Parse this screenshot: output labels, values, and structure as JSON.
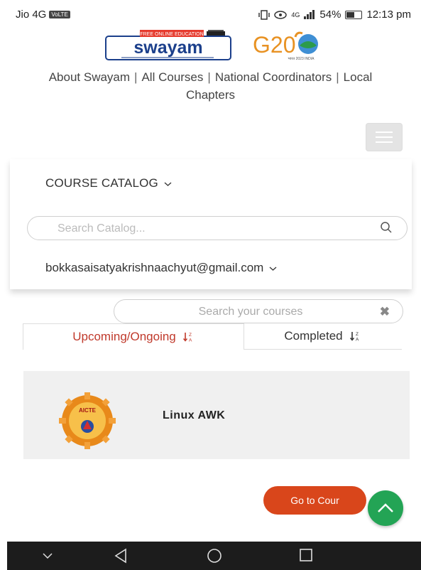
{
  "status_bar": {
    "carrier": "Jio 4G",
    "volte": "VoLTE",
    "signal_label": "4G",
    "battery": "54%",
    "time": "12:13 pm"
  },
  "logos": {
    "swayam_tag": "FREE ONLINE EDUCATION",
    "swayam_name": "swayam",
    "g20_name": "G20",
    "g20_tag": "भारत 2023 INDIA"
  },
  "top_nav": {
    "items": [
      "About Swayam",
      "All Courses",
      "National Coordinators",
      "Local Chapters"
    ],
    "separator": "|"
  },
  "catalog": {
    "course_catalog_label": "COURSE CATALOG",
    "search_placeholder": "Search Catalog...",
    "user_email": "bokkasaisatyakrishnaachyut@gmail.com"
  },
  "my_courses": {
    "search_placeholder": "Search your courses",
    "tabs": [
      {
        "label": "Upcoming/Ongoing",
        "active": true
      },
      {
        "label": "Completed",
        "active": false
      }
    ],
    "sort_icon": "sort-alpha-icon",
    "courses": [
      {
        "name": "Linux AWK",
        "logo_text": "AICTE",
        "button_label": "Go to Cour"
      }
    ]
  },
  "colors": {
    "accent": "#d9461b",
    "active_tab": "#c0392b",
    "scroll_button": "#23a455",
    "nav_bar": "#1c1c1c"
  }
}
